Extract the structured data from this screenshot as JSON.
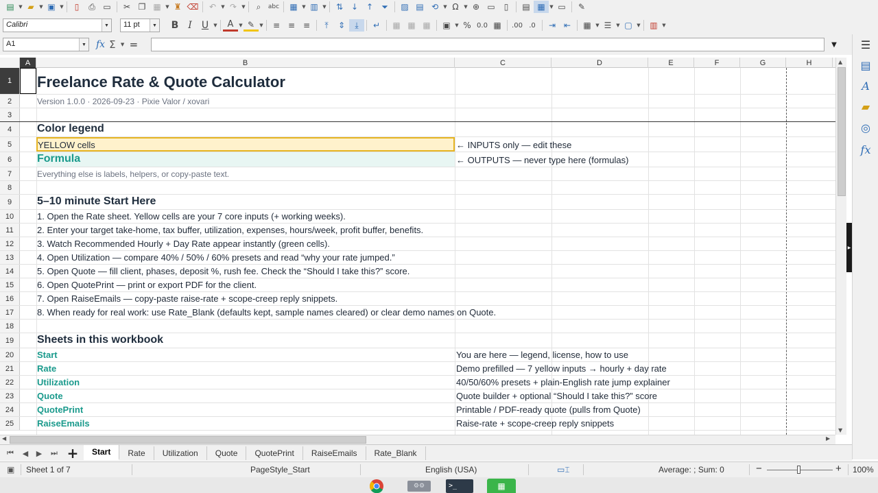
{
  "toolbar": {
    "font_name": "Calibri",
    "font_size": "11 pt"
  },
  "formula_bar": {
    "name_box": "A1",
    "formula_value": ""
  },
  "columns": [
    "A",
    "B",
    "C",
    "D",
    "E",
    "F",
    "G",
    "H"
  ],
  "rows": [
    {
      "n": "1",
      "b": "Freelance Rate & Quote Calculator",
      "c": ""
    },
    {
      "n": "2",
      "b": "Version 1.0.0  ·  2026-09-23  ·  Pixie Valor / xovari",
      "c": ""
    },
    {
      "n": "3",
      "b": "",
      "c": ""
    },
    {
      "n": "4",
      "b": "Color legend",
      "c": ""
    },
    {
      "n": "5",
      "b": "YELLOW cells",
      "c": "← INPUTS only — edit these"
    },
    {
      "n": "6",
      "b": "Formula",
      "c": "← OUTPUTS — never type here (formulas)"
    },
    {
      "n": "7",
      "b": "Everything else is labels, helpers, or copy-paste text.",
      "c": ""
    },
    {
      "n": "8",
      "b": "",
      "c": ""
    },
    {
      "n": "9",
      "b": "5–10 minute Start Here",
      "c": ""
    },
    {
      "n": "10",
      "b": "1. Open the Rate sheet. Yellow cells are your 7 core inputs (+ working weeks).",
      "c": ""
    },
    {
      "n": "11",
      "b": "2. Enter your target take-home, tax buffer, utilization, expenses, hours/week, profit buffer, benefits.",
      "c": ""
    },
    {
      "n": "12",
      "b": "3. Watch Recommended Hourly + Day Rate appear instantly (green cells).",
      "c": ""
    },
    {
      "n": "13",
      "b": "4. Open Utilization — compare 40% / 50% / 60% presets and read “why your rate jumped.”",
      "c": ""
    },
    {
      "n": "14",
      "b": "5. Open Quote — fill client, phases, deposit %, rush fee. Check the “Should I take this?” score.",
      "c": ""
    },
    {
      "n": "15",
      "b": "6. Open QuotePrint — print or export PDF for the client.",
      "c": ""
    },
    {
      "n": "16",
      "b": "7. Open RaiseEmails — copy-paste raise-rate + scope-creep reply snippets.",
      "c": ""
    },
    {
      "n": "17",
      "b": "8. When ready for real work: use Rate_Blank (defaults kept, sample names cleared) or clear demo names on Quote.",
      "c": ""
    },
    {
      "n": "18",
      "b": "",
      "c": ""
    },
    {
      "n": "19",
      "b": "Sheets in this workbook",
      "c": ""
    },
    {
      "n": "20",
      "b": "Start",
      "c": "You are here — legend, license, how to use"
    },
    {
      "n": "21",
      "b": "Rate",
      "c": "Demo prefilled — 7 yellow inputs → hourly + day rate"
    },
    {
      "n": "22",
      "b": "Utilization",
      "c": "40/50/60% presets + plain-English rate jump explainer"
    },
    {
      "n": "23",
      "b": "Quote",
      "c": "Quote builder + optional “Should I take this?” score"
    },
    {
      "n": "24",
      "b": "QuotePrint",
      "c": "Printable / PDF-ready quote (pulls from Quote)"
    },
    {
      "n": "25",
      "b": "RaiseEmails",
      "c": "Raise-rate + scope-creep reply snippets"
    }
  ],
  "sheet_tabs": [
    "Start",
    "Rate",
    "Utilization",
    "Quote",
    "QuotePrint",
    "RaiseEmails",
    "Rate_Blank"
  ],
  "active_tab": "Start",
  "status": {
    "sheet": "Sheet 1 of 7",
    "page_style": "PageStyle_Start",
    "language": "English (USA)",
    "summary": "Average: ; Sum: 0",
    "zoom": "100%"
  },
  "colors": {
    "input_yellow": "#fff2cc",
    "input_border": "#e6b422",
    "formula_teal": "#1a9a8c",
    "formula_bg": "#e8f6f3",
    "heading": "#1f2d3d"
  }
}
